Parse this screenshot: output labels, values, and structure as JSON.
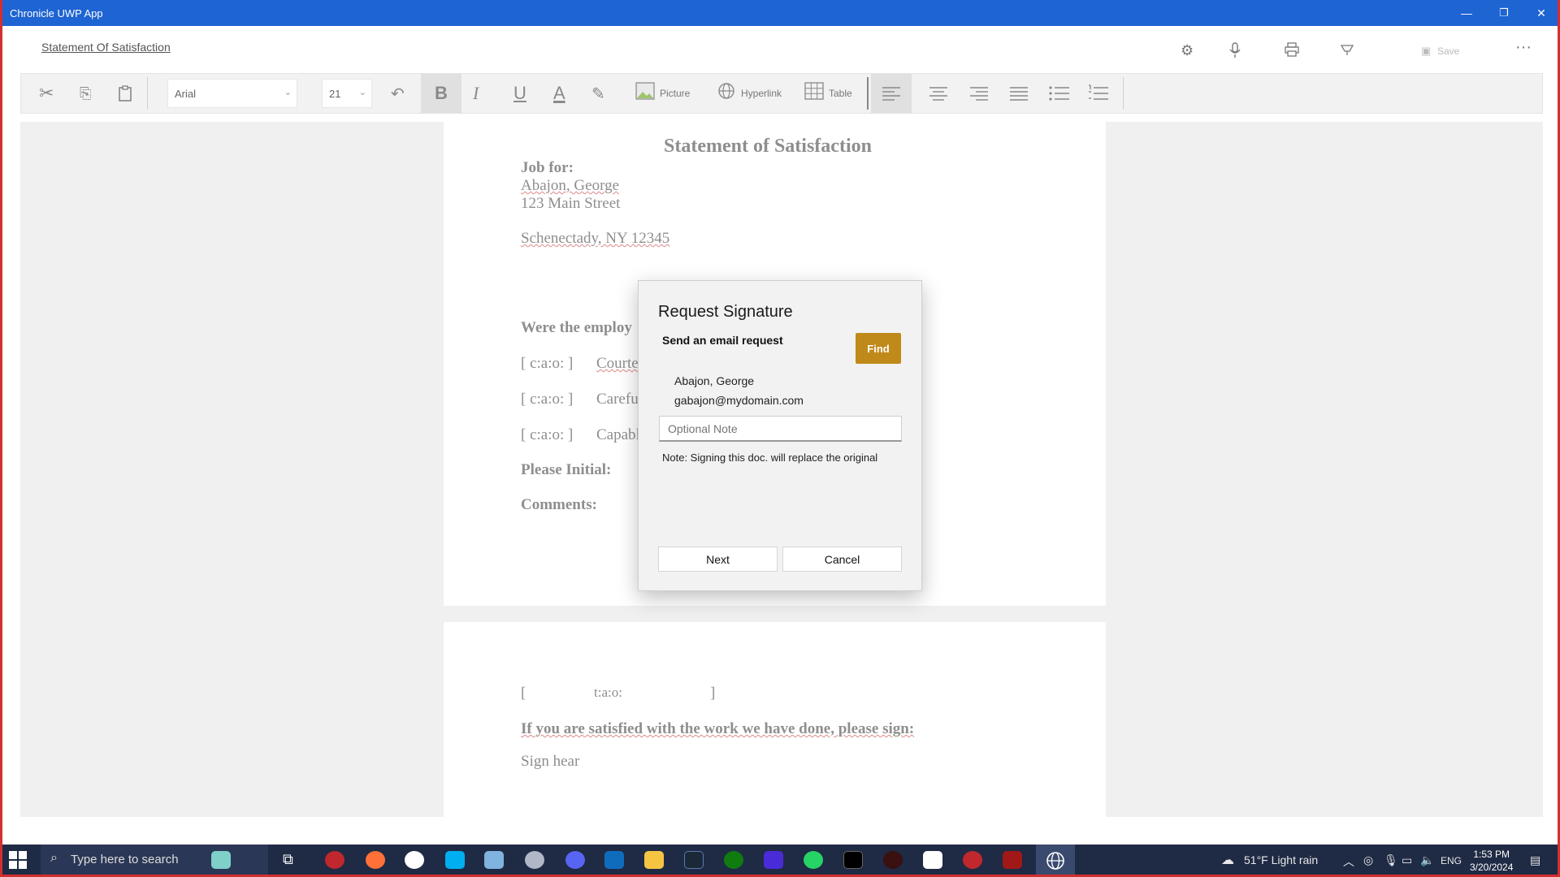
{
  "window": {
    "title": "Chronicle UWP App",
    "minimize": "—",
    "restore": "❐",
    "close": "✕"
  },
  "appbar": {
    "document_title": "Statement Of Satisfaction",
    "save_label": "Save",
    "more": "···"
  },
  "toolbar": {
    "font": "Arial",
    "font_size": "21",
    "picture_label": "Picture",
    "hyperlink_label": "Hyperlink",
    "table_label": "Table",
    "bold": "B",
    "italic": "I",
    "underline": "U",
    "font_color": "A"
  },
  "document": {
    "title": "Statement of Satisfaction",
    "job_for_label": "Job for:",
    "customer_name": "Abajon, George",
    "street": "123 Main Street",
    "city_line": "Schenectady, NY 12345",
    "question": "Were the employ",
    "options": [
      {
        "tag": "[ c:a:o: ]",
        "label": "Courteou"
      },
      {
        "tag": "[ c:a:o: ]",
        "label": "Careful"
      },
      {
        "tag": "[ c:a:o: ]",
        "label": "Capable"
      }
    ],
    "initial_label": "Please Initial:",
    "initial_bracket": "[",
    "comments_label": "Comments:",
    "page2_open": "[",
    "page2_tag": "t:a:o:",
    "page2_close": "]",
    "sign_prompt": "If you are satisfied with the work we have done, please sign:",
    "sign_here": "Sign hear"
  },
  "dialog": {
    "title": "Request Signature",
    "subtitle": "Send an email request",
    "find_label": "Find",
    "recipient_name": "Abajon, George",
    "recipient_email": "gabajon@mydomain.com",
    "note_placeholder": "Optional Note",
    "warning": "Note: Signing this doc. will replace the original",
    "next_label": "Next",
    "cancel_label": "Cancel"
  },
  "taskbar": {
    "search_placeholder": "Type here to search",
    "weather": "51°F  Light rain",
    "language": "ENG",
    "time": "1:53 PM",
    "date": "3/20/2024"
  },
  "colors": {
    "titlebar": "#1e64d2",
    "frame": "#d32f2f",
    "find_button": "#c08a1a",
    "taskbar": "#1f2a44"
  }
}
